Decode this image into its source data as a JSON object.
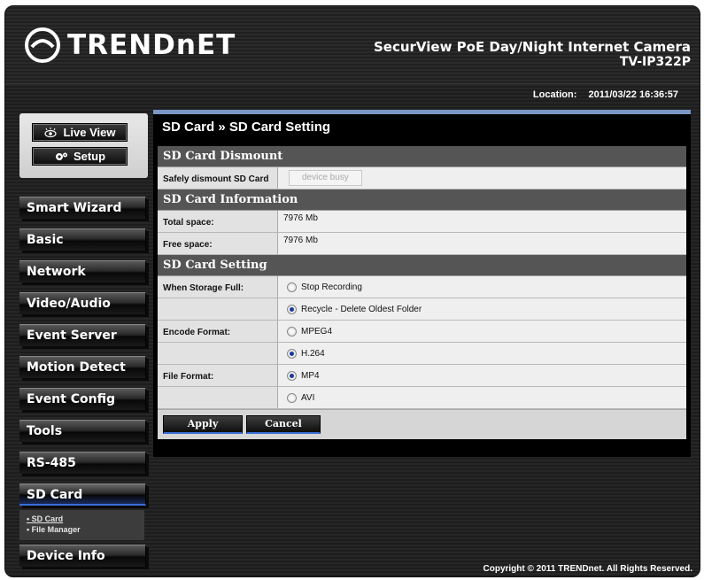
{
  "brand": {
    "logo_text": "TRENDnET",
    "product_name": "SecurView PoE Day/Night Internet Camera",
    "model": "TV-IP322P"
  },
  "location": {
    "label": "Location:",
    "datetime": "2011/03/22 16:36:57"
  },
  "top_buttons": {
    "live_view": "Live View",
    "setup": "Setup"
  },
  "nav": {
    "items": [
      {
        "label": "Smart Wizard"
      },
      {
        "label": "Basic"
      },
      {
        "label": "Network"
      },
      {
        "label": "Video/Audio"
      },
      {
        "label": "Event Server"
      },
      {
        "label": "Motion Detect"
      },
      {
        "label": "Event Config"
      },
      {
        "label": "Tools"
      },
      {
        "label": "RS-485"
      },
      {
        "label": "SD Card"
      },
      {
        "label": "Device Info"
      }
    ],
    "active": "SD Card",
    "sub": {
      "sd_card": "• SD Card",
      "file_manager": "• File Manager"
    }
  },
  "panel": {
    "title": "SD Card » SD Card Setting",
    "dismount": {
      "heading": "SD Card Dismount",
      "label": "Safely dismount SD Card",
      "button": "device busy"
    },
    "info": {
      "heading": "SD Card Information",
      "total_label": "Total space:",
      "total_value": "7976 Mb",
      "free_label": "Free space:",
      "free_value": "7976 Mb"
    },
    "setting": {
      "heading": "SD Card Setting",
      "storage_label": "When Storage Full:",
      "storage_options": [
        "Stop Recording",
        "Recycle - Delete Oldest Folder"
      ],
      "storage_selected": "Recycle - Delete Oldest Folder",
      "encode_label": "Encode Format:",
      "encode_options": [
        "MPEG4",
        "H.264"
      ],
      "encode_selected": "H.264",
      "file_label": "File Format:",
      "file_options": [
        "MP4",
        "AVI"
      ],
      "file_selected": "MP4"
    },
    "apply": "Apply",
    "cancel": "Cancel"
  },
  "footer": "Copyright © 2011 TRENDnet. All Rights Reserved.",
  "colors": {
    "accent": "#3a6dd8",
    "panel_border": "#7a96c8",
    "section_header": "#555555"
  }
}
